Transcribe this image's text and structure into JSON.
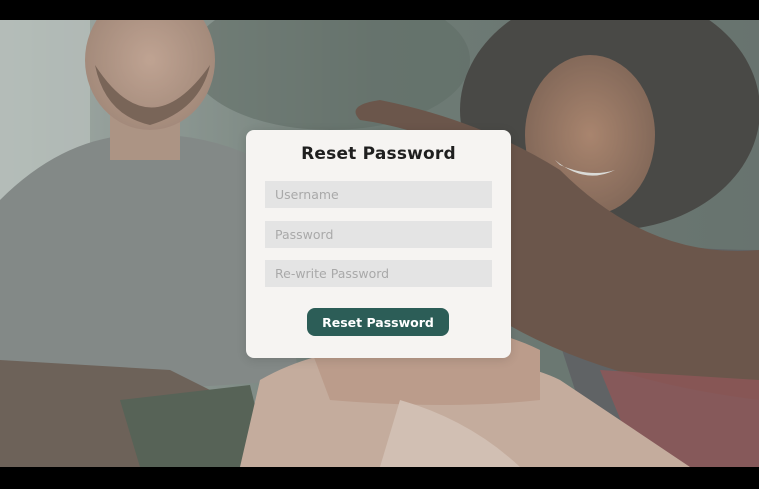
{
  "background": {
    "image": "people-stacking-hands-photo"
  },
  "form": {
    "title": "Reset Password",
    "username_placeholder": "Username",
    "password_placeholder": "Password",
    "rewrite_password_placeholder": "Re-write Password",
    "submit_label": "Reset Password"
  },
  "colors": {
    "button": "#2c5d57",
    "card": "#f6f4f2",
    "field": "#e4e4e4"
  }
}
